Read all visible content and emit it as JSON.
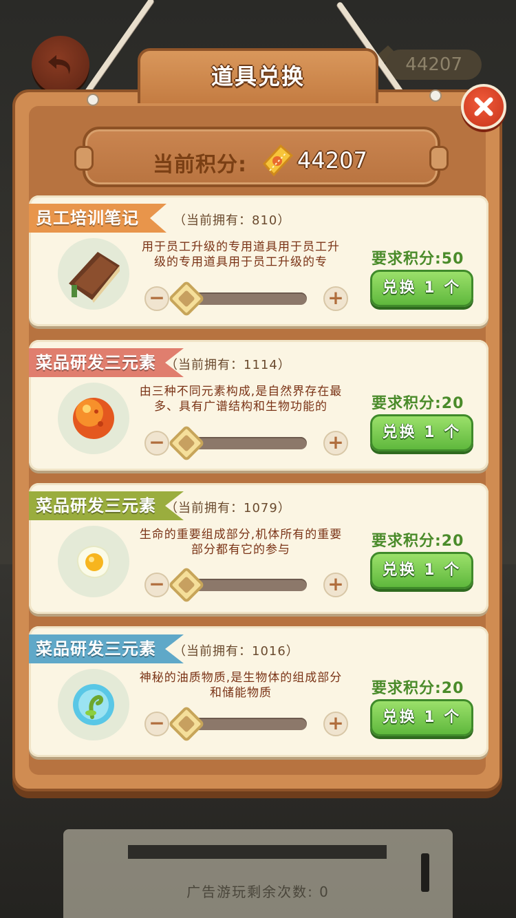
{
  "header": {
    "title": "道具兑换",
    "top_score": "44207"
  },
  "points": {
    "label": "当前积分:",
    "value": "44207"
  },
  "items": [
    {
      "name": "员工培训笔记",
      "owned": "（当前拥有：810）",
      "desc": "用于员工升级的专用道具用于员工升级的专用道具用于员工升级的专",
      "required": "要求积分:50",
      "button": "兑换 1 个",
      "ribbon_color": "#e8954b",
      "icon": "notebook-icon",
      "slider_value": 0
    },
    {
      "name": "菜品研发三元素",
      "owned": "（当前拥有：1114）",
      "desc": "由三种不同元素构成,是自然界存在最多、具有广谱结构和生物功能的",
      "required": "要求积分:20",
      "button": "兑换 1 个",
      "ribbon_color": "#e07e6e",
      "icon": "orange-orb-icon",
      "slider_value": 0
    },
    {
      "name": "菜品研发三元素",
      "owned": "（当前拥有：1079）",
      "desc": "生命的重要组成部分,机体所有的重要部分都有它的参与",
      "required": "要求积分:20",
      "button": "兑换 1 个",
      "ribbon_color": "#9aad3e",
      "icon": "egg-icon",
      "slider_value": 0
    },
    {
      "name": "菜品研发三元素",
      "owned": "（当前拥有：1016）",
      "desc": "神秘的油质物质,是生物体的组成部分和储能物质",
      "required": "要求积分:20",
      "button": "兑换 1 个",
      "ribbon_color": "#5fa8c8",
      "icon": "sprout-bubble-icon",
      "slider_value": 0
    }
  ],
  "footer": {
    "ad_text": "广告游玩剩余次数: 0"
  }
}
